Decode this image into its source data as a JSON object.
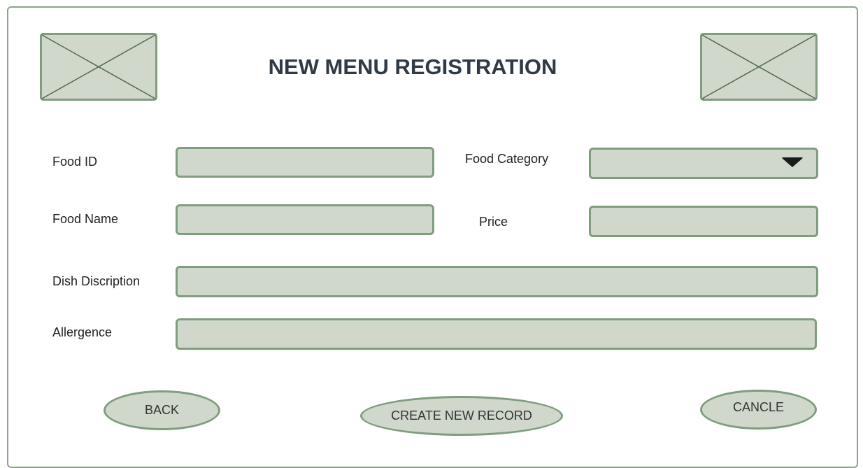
{
  "form": {
    "title": "NEW MENU REGISTRATION",
    "fields": {
      "food_id": {
        "label": "Food ID",
        "value": ""
      },
      "food_category": {
        "label": "Food Category",
        "value": ""
      },
      "food_name": {
        "label": "Food Name",
        "value": ""
      },
      "price": {
        "label": "Price",
        "value": ""
      },
      "dish_description": {
        "label": "Dish Discription",
        "value": ""
      },
      "allergence": {
        "label": "Allergence",
        "value": ""
      }
    },
    "buttons": {
      "back": "BACK",
      "create": "CREATE NEW RECORD",
      "cancel": "CANCLE"
    }
  },
  "icons": {
    "left_placeholder": "image-placeholder-icon",
    "right_placeholder": "image-placeholder-icon",
    "dropdown": "triangle-down-icon"
  },
  "colors": {
    "field_fill": "#d0d8cc",
    "field_border": "#7e9e7e",
    "frame_border": "#8aa58a",
    "title_text": "#2f3a45"
  }
}
